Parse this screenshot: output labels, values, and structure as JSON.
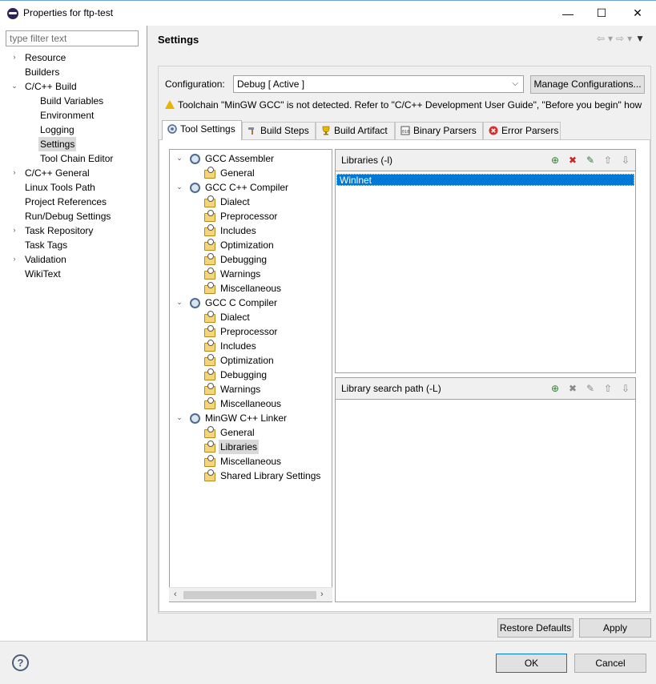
{
  "window": {
    "title": "Properties for ftp-test",
    "minimize": "—",
    "maximize": "☐",
    "close": "✕"
  },
  "filter": {
    "placeholder": "type filter text"
  },
  "nav": {
    "items": [
      {
        "label": "Resource",
        "expand": "›"
      },
      {
        "label": "Builders",
        "expand": ""
      },
      {
        "label": "C/C++ Build",
        "expand": "⌄"
      },
      {
        "label": "Build Variables",
        "expand": ""
      },
      {
        "label": "Environment",
        "expand": ""
      },
      {
        "label": "Logging",
        "expand": ""
      },
      {
        "label": "Settings",
        "expand": "",
        "selected": true
      },
      {
        "label": "Tool Chain Editor",
        "expand": ""
      },
      {
        "label": "C/C++ General",
        "expand": "›"
      },
      {
        "label": "Linux Tools Path",
        "expand": ""
      },
      {
        "label": "Project References",
        "expand": ""
      },
      {
        "label": "Run/Debug Settings",
        "expand": ""
      },
      {
        "label": "Task Repository",
        "expand": "›"
      },
      {
        "label": "Task Tags",
        "expand": ""
      },
      {
        "label": "Validation",
        "expand": "›"
      },
      {
        "label": "WikiText",
        "expand": ""
      }
    ]
  },
  "header": {
    "title": "Settings"
  },
  "config": {
    "label": "Configuration:",
    "selected": "Debug  [ Active ]",
    "manage_button": "Manage Configurations...",
    "warning": "Toolchain \"MinGW GCC\" is not detected. Refer to \"C/C++ Development User Guide\", \"Before you begin\" how"
  },
  "tabs": [
    "Tool Settings",
    "Build Steps",
    "Build Artifact",
    "Binary Parsers",
    "Error Parsers"
  ],
  "tree": [
    {
      "label": "GCC Assembler",
      "level": 0
    },
    {
      "label": "General",
      "level": 1
    },
    {
      "label": "GCC C++ Compiler",
      "level": 0
    },
    {
      "label": "Dialect",
      "level": 1
    },
    {
      "label": "Preprocessor",
      "level": 1
    },
    {
      "label": "Includes",
      "level": 1
    },
    {
      "label": "Optimization",
      "level": 1
    },
    {
      "label": "Debugging",
      "level": 1
    },
    {
      "label": "Warnings",
      "level": 1
    },
    {
      "label": "Miscellaneous",
      "level": 1
    },
    {
      "label": "GCC C Compiler",
      "level": 0
    },
    {
      "label": "Dialect",
      "level": 1
    },
    {
      "label": "Preprocessor",
      "level": 1
    },
    {
      "label": "Includes",
      "level": 1
    },
    {
      "label": "Optimization",
      "level": 1
    },
    {
      "label": "Debugging",
      "level": 1
    },
    {
      "label": "Warnings",
      "level": 1
    },
    {
      "label": "Miscellaneous",
      "level": 1
    },
    {
      "label": "MinGW C++ Linker",
      "level": 0
    },
    {
      "label": "General",
      "level": 1
    },
    {
      "label": "Libraries",
      "level": 1,
      "selected": true
    },
    {
      "label": "Miscellaneous",
      "level": 1
    },
    {
      "label": "Shared Library Settings",
      "level": 1
    }
  ],
  "libraries": {
    "title": "Libraries (-l)",
    "items": [
      "Winlnet"
    ]
  },
  "library_paths": {
    "title": "Library search path (-L)",
    "items": []
  },
  "buttons": {
    "restore": "Restore Defaults",
    "apply": "Apply",
    "ok": "OK",
    "cancel": "Cancel"
  },
  "help": {
    "glyph": "?"
  }
}
